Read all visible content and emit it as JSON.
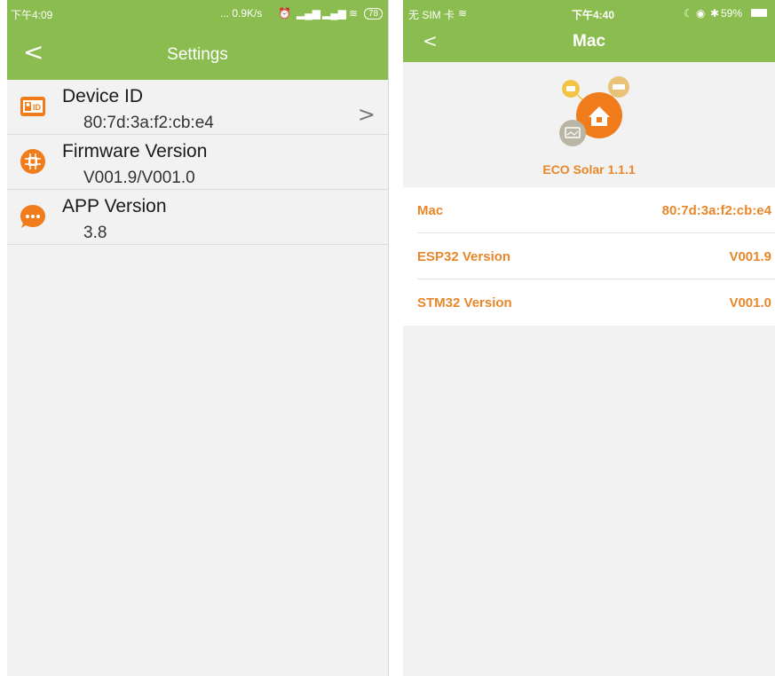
{
  "left": {
    "status": {
      "time": "下午4:09",
      "net": "... 0.9K/s",
      "battery": "78"
    },
    "appbar": {
      "back": "<",
      "title": "Settings"
    },
    "rows": [
      {
        "label": "Device ID",
        "value": "80:7d:3a:f2:cb:e4",
        "icon": "id-card-icon",
        "chevron": ">"
      },
      {
        "label": "Firmware Version",
        "value": "V001.9/V001.0",
        "icon": "chip-icon"
      },
      {
        "label": "APP Version",
        "value": "3.8",
        "icon": "chat-bubble-icon"
      }
    ]
  },
  "right": {
    "status": {
      "carrier": "无 SIM 卡",
      "time": "下午4:40",
      "battery": "59%"
    },
    "nav": {
      "back": "<",
      "title": "Mac"
    },
    "app_name": "ECO Solar 1.1.1",
    "rows": [
      {
        "key": "Mac",
        "value": "80:7d:3a:f2:cb:e4"
      },
      {
        "key": "ESP32 Version",
        "value": "V001.9"
      },
      {
        "key": "STM32 Version",
        "value": "V001.0"
      }
    ]
  },
  "colors": {
    "header_green": "#8bbc4f",
    "accent_orange": "#e8872a"
  }
}
